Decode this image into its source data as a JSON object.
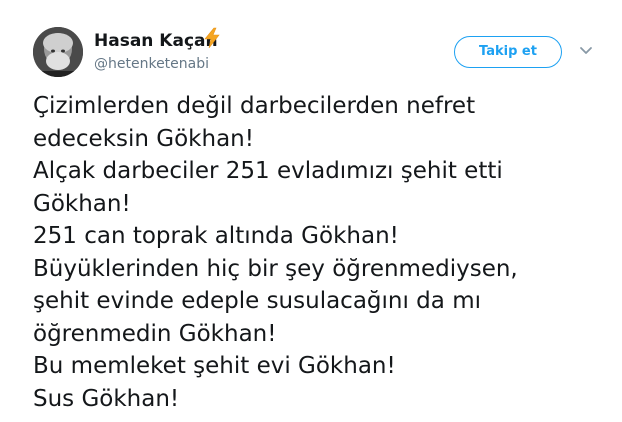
{
  "user": {
    "display_name": "Hasan Kaçan",
    "handle": "@hetenketenabi",
    "badge_icon": "lightning-bolt-icon",
    "badge_color": "#f5a623",
    "avatar_icon": "profile-avatar"
  },
  "actions": {
    "follow_label": "Takip et",
    "menu_icon": "chevron-down-icon",
    "accent_color": "#1da1f2"
  },
  "tweet": {
    "lines": [
      "Çizimlerden değil darbecilerden nefret",
      "edeceksin Gökhan!",
      "Alçak darbeciler 251 evladımızı şehit etti",
      "Gökhan!",
      "251 can toprak altında Gökhan!",
      "Büyüklerinden hiç bir şey öğrenmediysen,",
      "şehit evinde edeple susulacağını da mı",
      "öğrenmedin Gökhan!",
      "Bu memleket şehit evi Gökhan!",
      "Sus Gökhan!"
    ]
  }
}
